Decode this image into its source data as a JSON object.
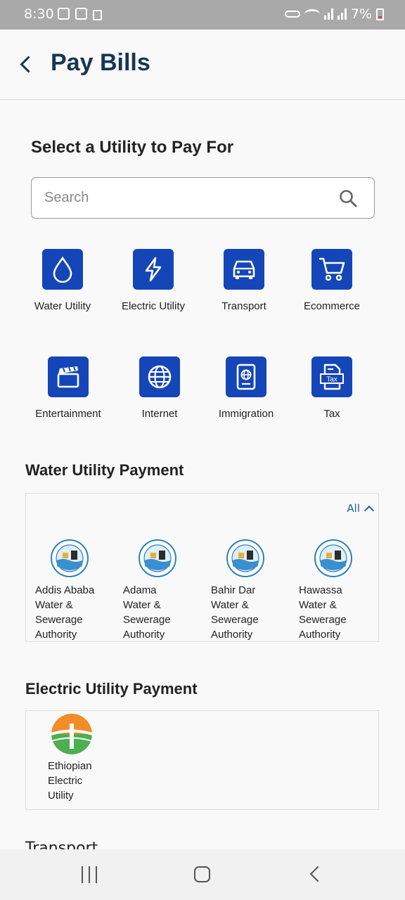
{
  "status_bar": {
    "time": "8:30",
    "battery": "7%"
  },
  "header": {
    "title": "Pay Bills"
  },
  "main": {
    "heading": "Select a Utility to Pay For",
    "search": {
      "placeholder": "Search",
      "value": ""
    },
    "categories": [
      {
        "label": "Water Utility",
        "icon": "water-drop-icon"
      },
      {
        "label": "Electric Utility",
        "icon": "lightning-icon"
      },
      {
        "label": "Transport",
        "icon": "car-icon"
      },
      {
        "label": "Ecommerce",
        "icon": "cart-icon"
      },
      {
        "label": "Entertainment",
        "icon": "clapperboard-icon"
      },
      {
        "label": "Internet",
        "icon": "globe-icon"
      },
      {
        "label": "Immigration",
        "icon": "passport-icon"
      },
      {
        "label": "Tax",
        "icon": "tax-document-icon",
        "icon_text": "Tax"
      }
    ],
    "water_section": {
      "title": "Water Utility Payment",
      "toggle_label": "All",
      "providers": [
        {
          "name": "Addis Ababa\nWater &\nSewerage\nAuthority"
        },
        {
          "name": "Adama\nWater &\nSewerage\nAuthority"
        },
        {
          "name": "Bahir Dar\nWater &\nSewerage\nAuthority"
        },
        {
          "name": "Hawassa\nWater &\nSewerage\nAuthority"
        }
      ]
    },
    "electric_section": {
      "title": "Electric Utility Payment",
      "providers": [
        {
          "name": "Ethiopian\nElectric\nUtility"
        }
      ]
    },
    "next_section_peek": "Transport"
  },
  "colors": {
    "brand": "#1446b8",
    "title": "#163652",
    "link": "#1f5fb0"
  }
}
